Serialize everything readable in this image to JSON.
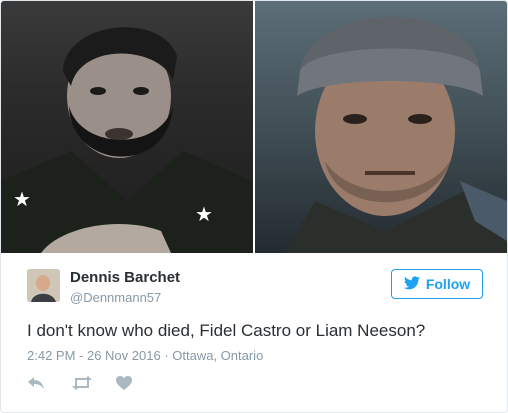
{
  "tweet": {
    "author": {
      "name": "Dennis Barchet",
      "handle": "@Dennmann57"
    },
    "follow_label": "Follow",
    "text": "I don't know who died, Fidel Castro or Liam Neeson?",
    "timestamp": "2:42 PM - 26 Nov 2016",
    "separator": " · ",
    "location": "Ottawa, Ontario"
  },
  "icons": {
    "follow": "twitter-bird-icon",
    "reply": "reply-icon",
    "retweet": "retweet-icon",
    "like": "heart-icon"
  },
  "colors": {
    "accent": "#1da1f2",
    "text": "#292f33",
    "muted": "#8899a6",
    "border": "#e1e8ed"
  }
}
